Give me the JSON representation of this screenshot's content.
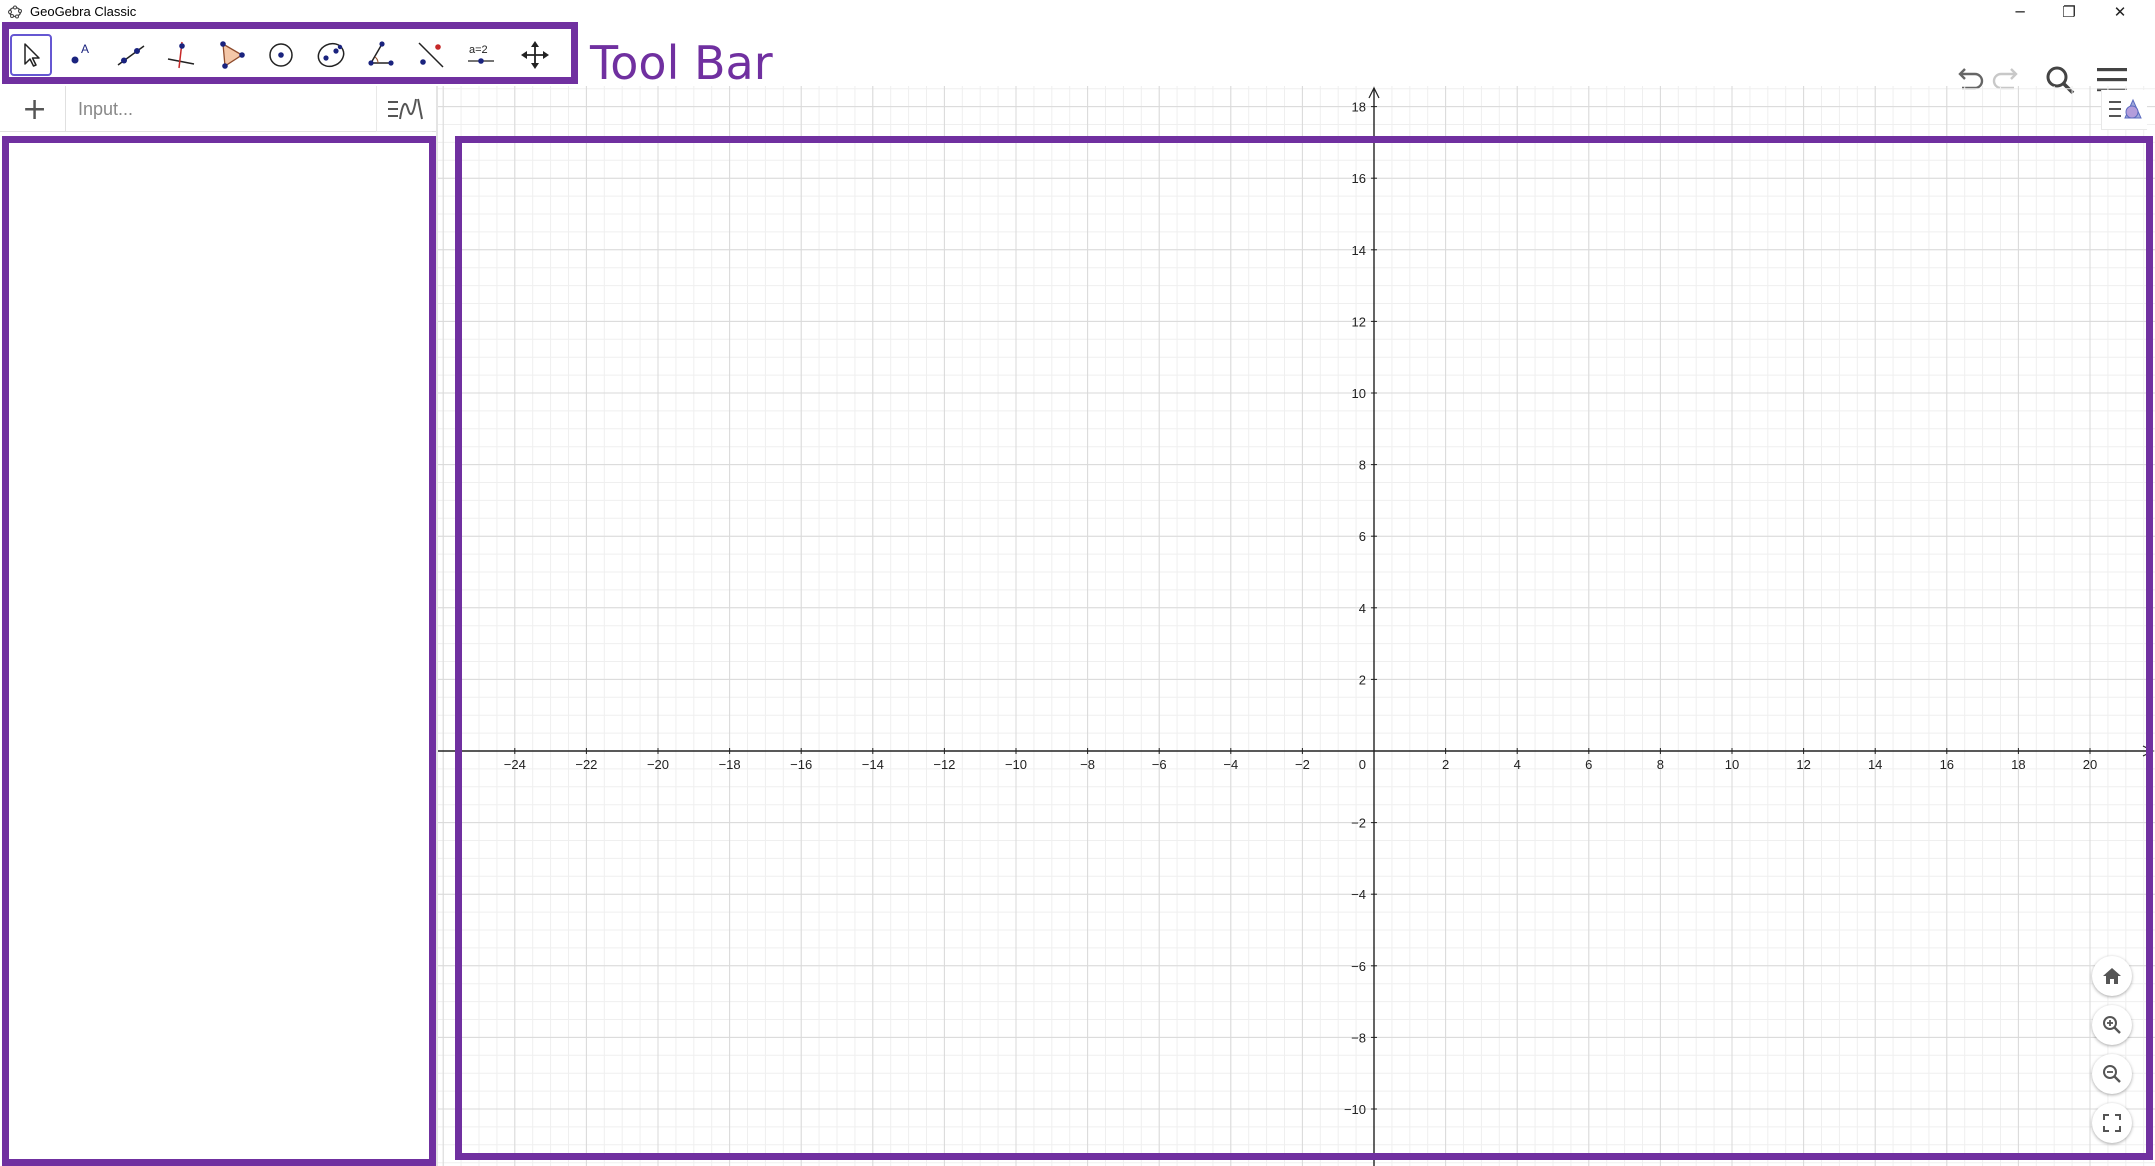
{
  "window": {
    "title": "GeoGebra Classic",
    "minimize": "─",
    "maximize": "❐",
    "close": "✕"
  },
  "toolbar": {
    "caption": "Tool Bar",
    "tools": [
      {
        "name": "move-tool-icon"
      },
      {
        "name": "point-tool-icon"
      },
      {
        "name": "line-tool-icon"
      },
      {
        "name": "perpendicular-line-tool-icon"
      },
      {
        "name": "polygon-tool-icon"
      },
      {
        "name": "circle-tool-icon"
      },
      {
        "name": "ellipse-tool-icon"
      },
      {
        "name": "angle-tool-icon"
      },
      {
        "name": "reflect-tool-icon"
      },
      {
        "name": "slider-tool-icon",
        "label": "a=2"
      },
      {
        "name": "move-graphics-view-tool-icon"
      }
    ],
    "right_icons": [
      "undo-icon",
      "redo-icon",
      "search-icon",
      "menu-icon"
    ]
  },
  "algebra": {
    "add_button": "+",
    "input_placeholder": "Input..."
  },
  "graphics": {
    "x_ticks": [
      "−24",
      "−22",
      "−20",
      "−18",
      "−16",
      "−14",
      "−12",
      "−10",
      "−8",
      "−6",
      "−4",
      "−2",
      "2",
      "4",
      "6",
      "8",
      "10",
      "12",
      "14",
      "16",
      "18",
      "20"
    ],
    "y_ticks": [
      "18",
      "16",
      "14",
      "12",
      "10",
      "8",
      "6",
      "4",
      "2",
      "−2",
      "−4",
      "−6",
      "−8",
      "−10"
    ],
    "origin_label": "0",
    "zoom_buttons": [
      "home-icon",
      "zoom-in-icon",
      "zoom-out-icon",
      "fullscreen-icon"
    ]
  },
  "colors": {
    "annotation": "#7030a0",
    "selected_tool_border": "#6557d2",
    "point_blue": "#1a237e",
    "grid_major": "#d9d9d9",
    "grid_minor": "#efefef"
  }
}
